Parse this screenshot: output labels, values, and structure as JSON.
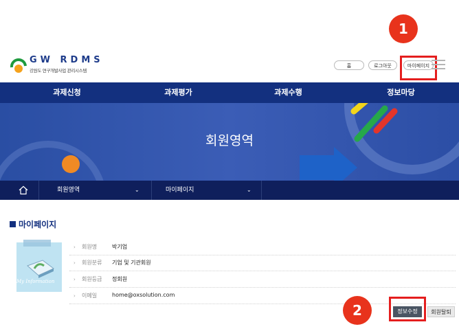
{
  "header": {
    "logo_title": "GW RDMS",
    "logo_subtitle": "강원도 연구개발사업 관리시스템",
    "home_label": "홈",
    "logout_label": "로그아웃",
    "mypage_label": "마이페이지"
  },
  "callouts": [
    "1",
    "2"
  ],
  "nav": {
    "items": [
      "과제신청",
      "과제평가",
      "과제수행",
      "정보마당"
    ]
  },
  "banner": {
    "title": "회원영역"
  },
  "subnav": {
    "level1": "회원영역",
    "level2": "마이페이지"
  },
  "section": {
    "title": "마이페이지",
    "image_caption": "My Information"
  },
  "member": {
    "rows": [
      {
        "label": "회원명",
        "value": "박기업"
      },
      {
        "label": "회원분류",
        "value": "기업 및 기관회원"
      },
      {
        "label": "회원등급",
        "value": "정회원"
      },
      {
        "label": "이메일",
        "value": "home@oxsolution.com"
      }
    ]
  },
  "actions": {
    "edit_label": "정보수정",
    "withdraw_label": "회원탈퇴"
  },
  "colors": {
    "nav": "#13307f",
    "subnav": "#0f1f5c",
    "callout": "#e8331c",
    "highlight": "#e41e1e"
  }
}
